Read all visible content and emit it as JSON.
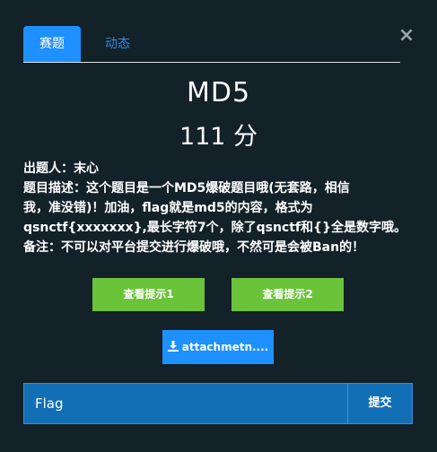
{
  "tabs": [
    {
      "label": "赛题",
      "active": true
    },
    {
      "label": "动态",
      "active": false
    }
  ],
  "close_icon": "close-icon",
  "challenge": {
    "title": "MD5",
    "points": "111 分",
    "author_line": "出题人：末心",
    "description_lines": [
      "题目描述：这个题目是一个MD5爆破题目哦(无套路，相信",
      "我，准没错)！加油，flag就是md5的内容，格式为",
      "qsnctf{xxxxxxx},最长字符7个，除了qsnctf和{}全是数字哦。",
      "备注：不可以对平台提交进行爆破哦，不然可是会被Ban的！"
    ]
  },
  "hints": {
    "hint1": "查看提示1",
    "hint2": "查看提示2"
  },
  "attachment": {
    "label": "attachmetn....",
    "icon": "download-icon"
  },
  "submit_form": {
    "placeholder": "Flag",
    "value": "",
    "submit_label": "提交"
  },
  "colors": {
    "background": "#132129",
    "accent_blue": "#1e90ff",
    "hint_green": "#6bc33a",
    "input_blue": "#126fb5"
  }
}
